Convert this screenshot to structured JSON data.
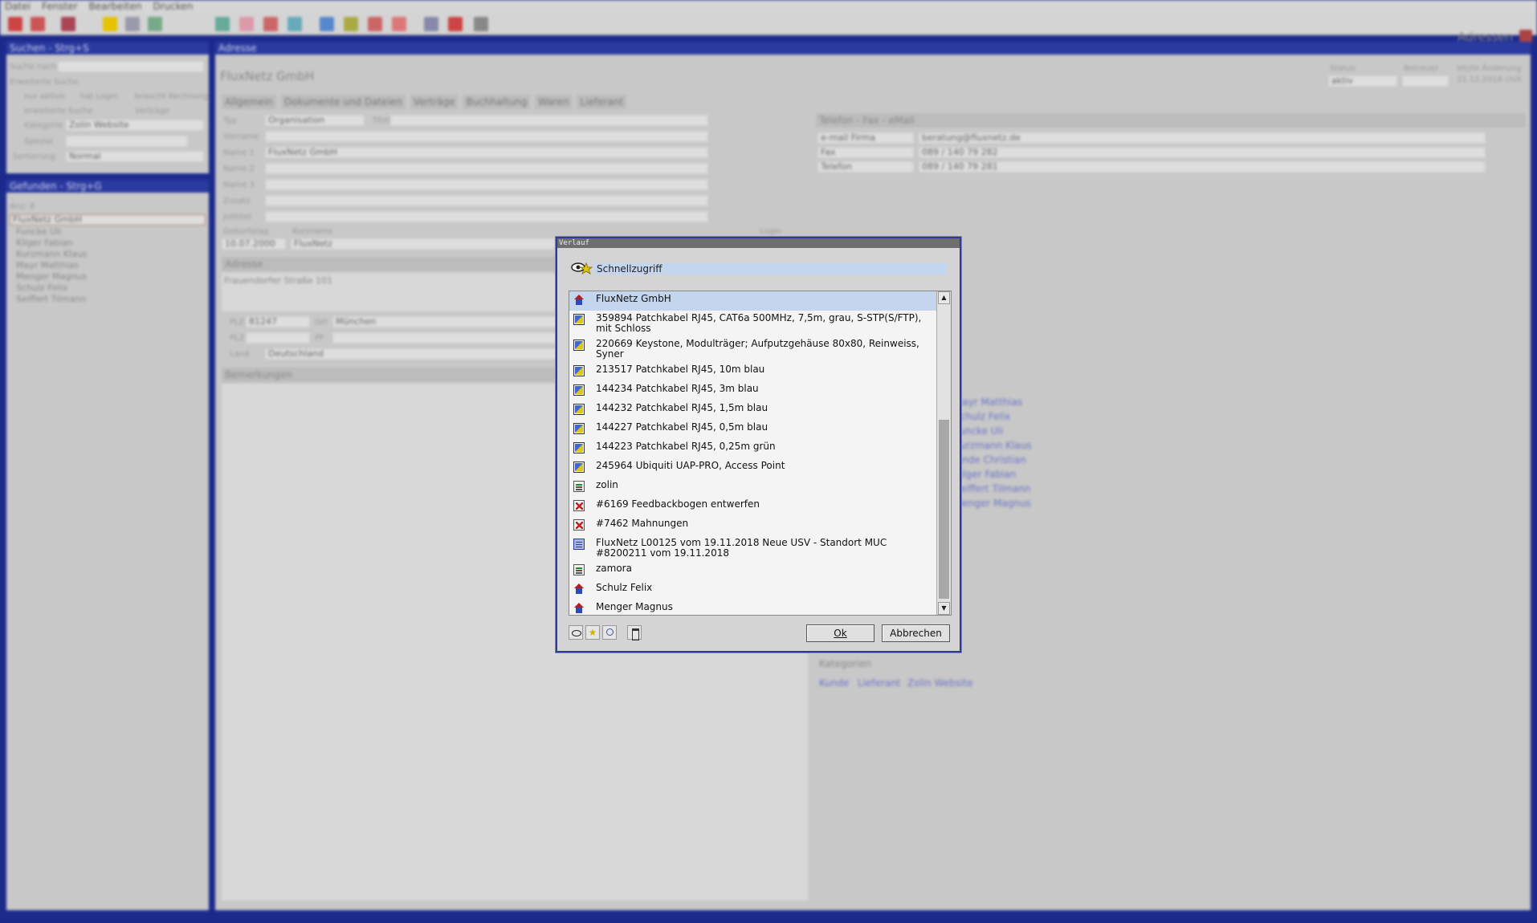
{
  "menubar": [
    "Datei",
    "Fenster",
    "Bearbeiten",
    "Drucken"
  ],
  "app_title": "Adressen",
  "search_panel": {
    "header": "Suchen - Strg+S",
    "search_label": "Suche nach",
    "extended_label": "Erweiterte Suche",
    "only_active": "nur aktive",
    "has_login": "hat Login",
    "needs_invoice": "braucht Rechnung",
    "extended_search": "erweiterte Suche",
    "contracts": "Verträge",
    "category_label": "Kategorie",
    "category_value": "Zolin Website",
    "special_label": "Spezial",
    "sort_label": "Sortierung",
    "sort_value": "Normal"
  },
  "found_panel": {
    "header": "Gefunden - Strg+G",
    "count": "Anz: 8",
    "items": [
      "FluxNetz GmbH",
      "Funcke Uli",
      "Kilger Fabian",
      "Kurzmann Klaus",
      "Mayr Matthias",
      "Menger Magnus",
      "Schulz Felix",
      "Seiffert Tilmann"
    ]
  },
  "address_panel": {
    "header": "Adresse",
    "title": "FluxNetz GmbH",
    "status_label": "Status",
    "status_value": "aktiv",
    "supervisor_label": "Betreuer",
    "last_change_label": "letzte Änderung",
    "last_change_value": "21.12.2018 chill",
    "tabs": [
      "Allgemein",
      "Dokumente und Dateien",
      "Verträge",
      "Buchhaltung",
      "Waren",
      "Lieferant"
    ],
    "type_label": "Typ",
    "type_value": "Organisation",
    "title_label": "Titel",
    "firstname_label": "Vorname",
    "name1_label": "Name 1",
    "name1_value": "FluxNetz GmbH",
    "name2_label": "Name 2",
    "name3_label": "Name 3",
    "addition_label": "Zusatz",
    "jobtitle_label": "Jobtitel",
    "birthday_label": "Geburtstag",
    "birthday_value": "10.07.2000",
    "shortname_label": "Kurzname",
    "shortname_value": "FluxNetz",
    "login_label": "Login",
    "address_header": "Adresse",
    "street": "Frauendorfer Straße 101",
    "zip_label": "PLZ",
    "zip_value": "81247",
    "city_label": "Ort",
    "city_value": "München",
    "zip2_label": "PLZ",
    "po_label": "PF",
    "country_label": "Land",
    "country_value": "Deutschland",
    "remarks_header": "Bemerkungen",
    "contact_header": "Telefon - Fax - eMail",
    "contacts": [
      {
        "type": "e-mail Firma",
        "value": "beratung@fluxnetz.de"
      },
      {
        "type": "Fax",
        "value": "089 / 140 79 282"
      },
      {
        "type": "Telefon",
        "value": "089 / 140 79 281"
      }
    ],
    "persons": [
      "Mayr Matthias",
      "Schulz Felix",
      "Funcke Uli",
      "Kurzmann Klaus",
      "Linde Christian",
      "Kilger Fabian",
      "Seiffert Tilmann",
      "Menger Magnus"
    ],
    "categories_header": "Kategorien",
    "categories": [
      "Kunde",
      "Lieferant",
      "Zolin Website"
    ]
  },
  "dialog": {
    "title": "Verlauf",
    "quick_access": "Schnellzugriff",
    "items": [
      {
        "icon": "house",
        "text": "FluxNetz GmbH",
        "selected": true
      },
      {
        "icon": "product",
        "text": "359894 Patchkabel RJ45, CAT6a 500MHz, 7,5m, grau, S-STP(S/FTP), mit Schloss"
      },
      {
        "icon": "product",
        "text": "220669 Keystone, Modulträger; Aufputzgehäuse 80x80, Reinweiss, Syner"
      },
      {
        "icon": "product",
        "text": "213517 Patchkabel RJ45, 10m blau"
      },
      {
        "icon": "product",
        "text": "144234 Patchkabel RJ45, 3m blau"
      },
      {
        "icon": "product",
        "text": "144232 Patchkabel RJ45, 1,5m blau"
      },
      {
        "icon": "product",
        "text": "144227 Patchkabel RJ45, 0,5m blau"
      },
      {
        "icon": "product",
        "text": "144223 Patchkabel RJ45, 0,25m grün"
      },
      {
        "icon": "product",
        "text": "245964 Ubiquiti UAP-PRO, Access Point"
      },
      {
        "icon": "user",
        "text": "zolin"
      },
      {
        "icon": "task",
        "text": "#6169 Feedbackbogen entwerfen"
      },
      {
        "icon": "task",
        "text": "#7462 Mahnungen"
      },
      {
        "icon": "doc",
        "text": "FluxNetz L00125 vom 19.11.2018 Neue USV - Standort MUC #8200211 vom 19.11.2018"
      },
      {
        "icon": "user",
        "text": "zamora"
      },
      {
        "icon": "house",
        "text": "Schulz Felix"
      },
      {
        "icon": "house",
        "text": "Menger Magnus"
      }
    ],
    "ok_label": "Ok",
    "cancel_label": "Abbrechen"
  }
}
